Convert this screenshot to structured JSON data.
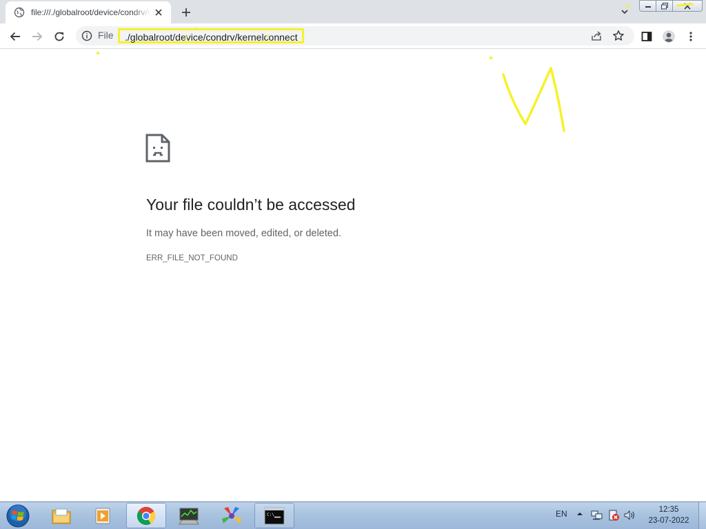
{
  "window": {
    "tab": {
      "title": "file:///./globalroot/device/condrv/kernelconnect",
      "favicon": "globe-icon",
      "close_icon": "close-icon"
    },
    "new_tab_icon": "plus-icon",
    "tab_search_icon": "chevron-down-icon",
    "caption_buttons": [
      "minimize-icon",
      "restore-icon",
      "close-icon"
    ]
  },
  "toolbar": {
    "back_icon": "arrow-left-icon",
    "forward_icon": "arrow-right-icon",
    "reload_icon": "reload-icon",
    "omnibox": {
      "info_icon": "info-icon",
      "scheme_chip": "File",
      "url": "./globalroot/device/condrv/kernelconnect",
      "url_highlight_color": "#f5f22a"
    },
    "share_icon": "share-icon",
    "bookmark_icon": "star-icon",
    "side_panel_icon": "side-panel-icon",
    "profile_icon": "profile-icon",
    "menu_icon": "kebab-menu-icon"
  },
  "error_page": {
    "icon": "sad-file-icon",
    "heading": "Your file couldn’t be accessed",
    "message": "It may have been moved, edited, or deleted.",
    "error_code": "ERR_FILE_NOT_FOUND"
  },
  "annotations": {
    "color": "#f5f22a"
  },
  "taskbar": {
    "start_icon": "windows-orb-icon",
    "apps": [
      {
        "name": "file-explorer-icon",
        "state": "pinned"
      },
      {
        "name": "media-player-icon",
        "state": "pinned"
      },
      {
        "name": "chrome-icon",
        "state": "active"
      },
      {
        "name": "task-manager-icon",
        "state": "pinned"
      },
      {
        "name": "app-icon",
        "state": "pinned"
      },
      {
        "name": "command-prompt-icon",
        "state": "open"
      }
    ],
    "tray": {
      "language": "EN",
      "show_hidden_icon": "chevron-up-icon",
      "icons": [
        "network-icon",
        "action-center-icon",
        "volume-icon"
      ],
      "time": "12:35",
      "date": "23-07-2022"
    }
  }
}
